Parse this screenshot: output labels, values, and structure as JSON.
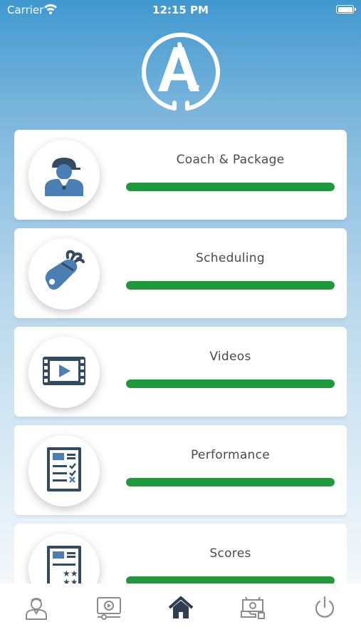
{
  "status_bar": {
    "carrier": "Carrier",
    "time": "12:15 PM",
    "icons": [
      "wifi-icon",
      "battery-icon"
    ]
  },
  "logo": {
    "letter": "A",
    "icon": "golf-club-logo",
    "color": "#ffffff"
  },
  "menu": [
    {
      "title": "Coach & Package",
      "icon": "coach-icon",
      "progress_percent": 100
    },
    {
      "title": "Scheduling",
      "icon": "golf-bag-icon",
      "progress_percent": 100
    },
    {
      "title": "Videos",
      "icon": "video-film-icon",
      "progress_percent": 100
    },
    {
      "title": "Performance",
      "icon": "checklist-icon",
      "progress_percent": 100
    },
    {
      "title": "Scores",
      "icon": "scorecard-icon",
      "progress_percent": 100
    }
  ],
  "tab_bar": {
    "tabs": [
      {
        "name": "profile",
        "icon": "profile-icon",
        "active": false
      },
      {
        "name": "videos",
        "icon": "video-player-icon",
        "active": false
      },
      {
        "name": "home",
        "icon": "home-icon",
        "active": true
      },
      {
        "name": "payments",
        "icon": "money-icon",
        "active": false
      },
      {
        "name": "logout",
        "icon": "power-icon",
        "active": false
      }
    ]
  },
  "colors": {
    "progress_fill": "#1e9a3d",
    "icon_dark": "#344a62",
    "icon_blue": "#4b7fb3",
    "tab_inactive": "#8c8c8c",
    "tab_active": "#2f3d4f",
    "header_blue": "#3f98d0"
  }
}
